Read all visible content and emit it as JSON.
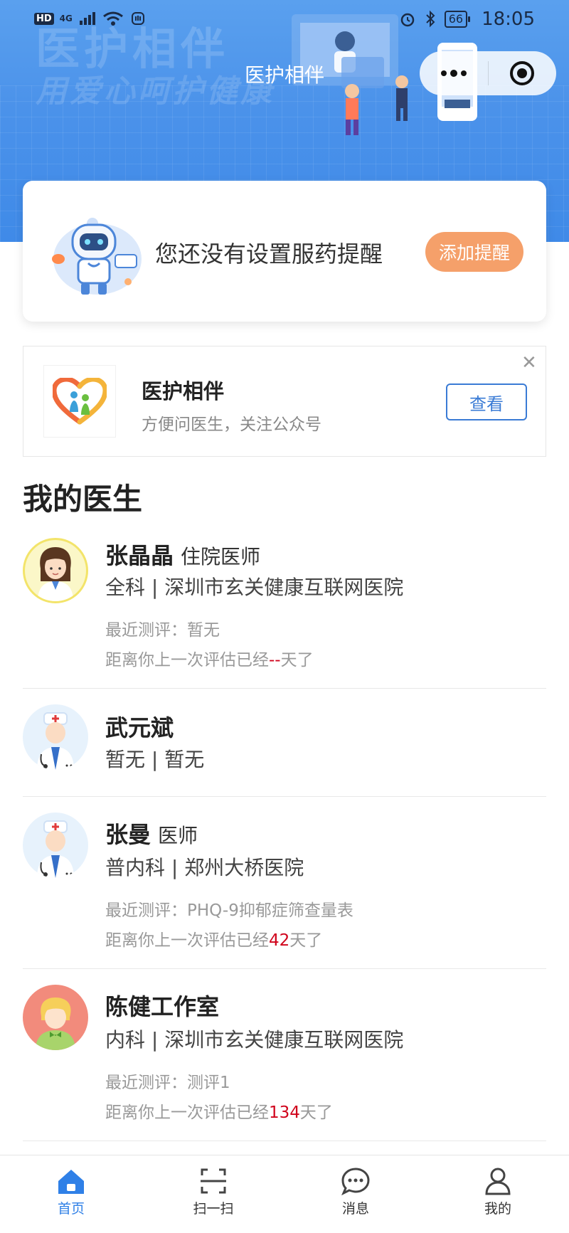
{
  "status_bar": {
    "network": "4G",
    "hd": "HD",
    "battery": "66",
    "time": "18:05"
  },
  "banner": {
    "watermark_line1": "医护相伴",
    "watermark_line2": "用爱心呵护健康"
  },
  "nav": {
    "title": "医护相伴",
    "more_icon": "more-dots-icon",
    "close_icon": "target-close-icon"
  },
  "reminder": {
    "text": "您还没有设置服药提醒",
    "button_label": "添加提醒",
    "button_color": "#f5a06a"
  },
  "official_account": {
    "name": "医护相伴",
    "description": "方便问医生，关注公众号",
    "view_label": "查看",
    "close_glyph": "✕"
  },
  "doctors_section": {
    "title": "我的医生",
    "doctors": [
      {
        "name": "张晶晶",
        "title": "住院医师",
        "department_hospital": "全科 | 深圳市玄关健康互联网医院",
        "eval_prefix": "最近测评：",
        "eval_value": "暂无",
        "days_prefix": "距离你上一次评估已经",
        "days_value": "--",
        "days_suffix": "天了",
        "avatar": "female-doctor-avatar"
      },
      {
        "name": "武元斌",
        "title": "",
        "department_hospital": "暂无 | 暂无",
        "avatar": "male-doctor-avatar"
      },
      {
        "name": "张曼",
        "title": "医师",
        "department_hospital": "普内科 | 郑州大桥医院",
        "eval_prefix": "最近测评：",
        "eval_value": "PHQ-9抑郁症筛查量表",
        "days_prefix": "距离你上一次评估已经",
        "days_value": "42",
        "days_suffix": "天了",
        "avatar": "male-doctor-avatar"
      },
      {
        "name": "陈健工作室",
        "title": "",
        "department_hospital": "内科 | 深圳市玄关健康互联网医院",
        "eval_prefix": "最近测评：",
        "eval_value": "测评1",
        "days_prefix": "距离你上一次评估已经",
        "days_value": "134",
        "days_suffix": "天了",
        "avatar": "studio-avatar"
      }
    ]
  },
  "tabbar": {
    "tabs": [
      {
        "label": "首页",
        "icon": "home-icon",
        "active": true
      },
      {
        "label": "扫一扫",
        "icon": "scan-icon",
        "active": false
      },
      {
        "label": "消息",
        "icon": "message-icon",
        "active": false
      },
      {
        "label": "我的",
        "icon": "user-icon",
        "active": false
      }
    ],
    "active_color": "#2f80e7"
  }
}
